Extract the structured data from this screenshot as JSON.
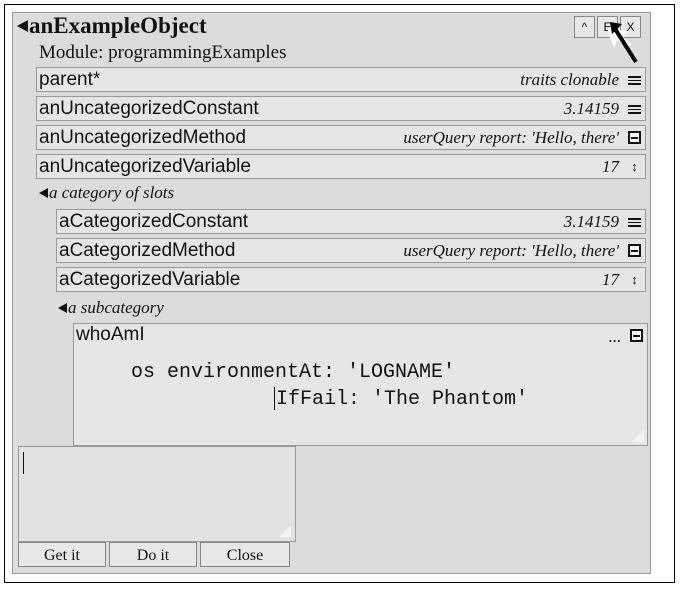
{
  "window": {
    "title": "anExampleObject",
    "module_label": "Module: programmingExamples",
    "buttons": {
      "up": "^",
      "edit": "E",
      "close": "X"
    }
  },
  "slots": [
    {
      "name": "parent*",
      "value": "traits clonable",
      "kind": "constant"
    },
    {
      "name": "anUncategorizedConstant",
      "value": "3.14159",
      "kind": "constant"
    },
    {
      "name": "anUncategorizedMethod",
      "value": "userQuery report: 'Hello, there'",
      "kind": "method"
    },
    {
      "name": "anUncategorizedVariable",
      "value": "17",
      "kind": "variable"
    }
  ],
  "category": {
    "label": "a category of slots",
    "slots": [
      {
        "name": "aCategorizedConstant",
        "value": "3.14159",
        "kind": "constant"
      },
      {
        "name": "aCategorizedMethod",
        "value": "userQuery report: 'Hello, there'",
        "kind": "method"
      },
      {
        "name": "aCategorizedVariable",
        "value": "17",
        "kind": "variable"
      }
    ],
    "subcategory": {
      "label": "a subcategory",
      "method": {
        "name": "whoAmI",
        "value": "...",
        "code_line1": "os environmentAt: 'LOGNAME'",
        "code_line2": "IfFail: 'The Phantom'"
      }
    }
  },
  "evaluator": {
    "text": "",
    "buttons": {
      "get": "Get it",
      "do": "Do it",
      "close": "Close"
    }
  },
  "icons": {
    "expander": "triangle-collapse-icon",
    "cursor": "arrow-pointer-icon"
  }
}
